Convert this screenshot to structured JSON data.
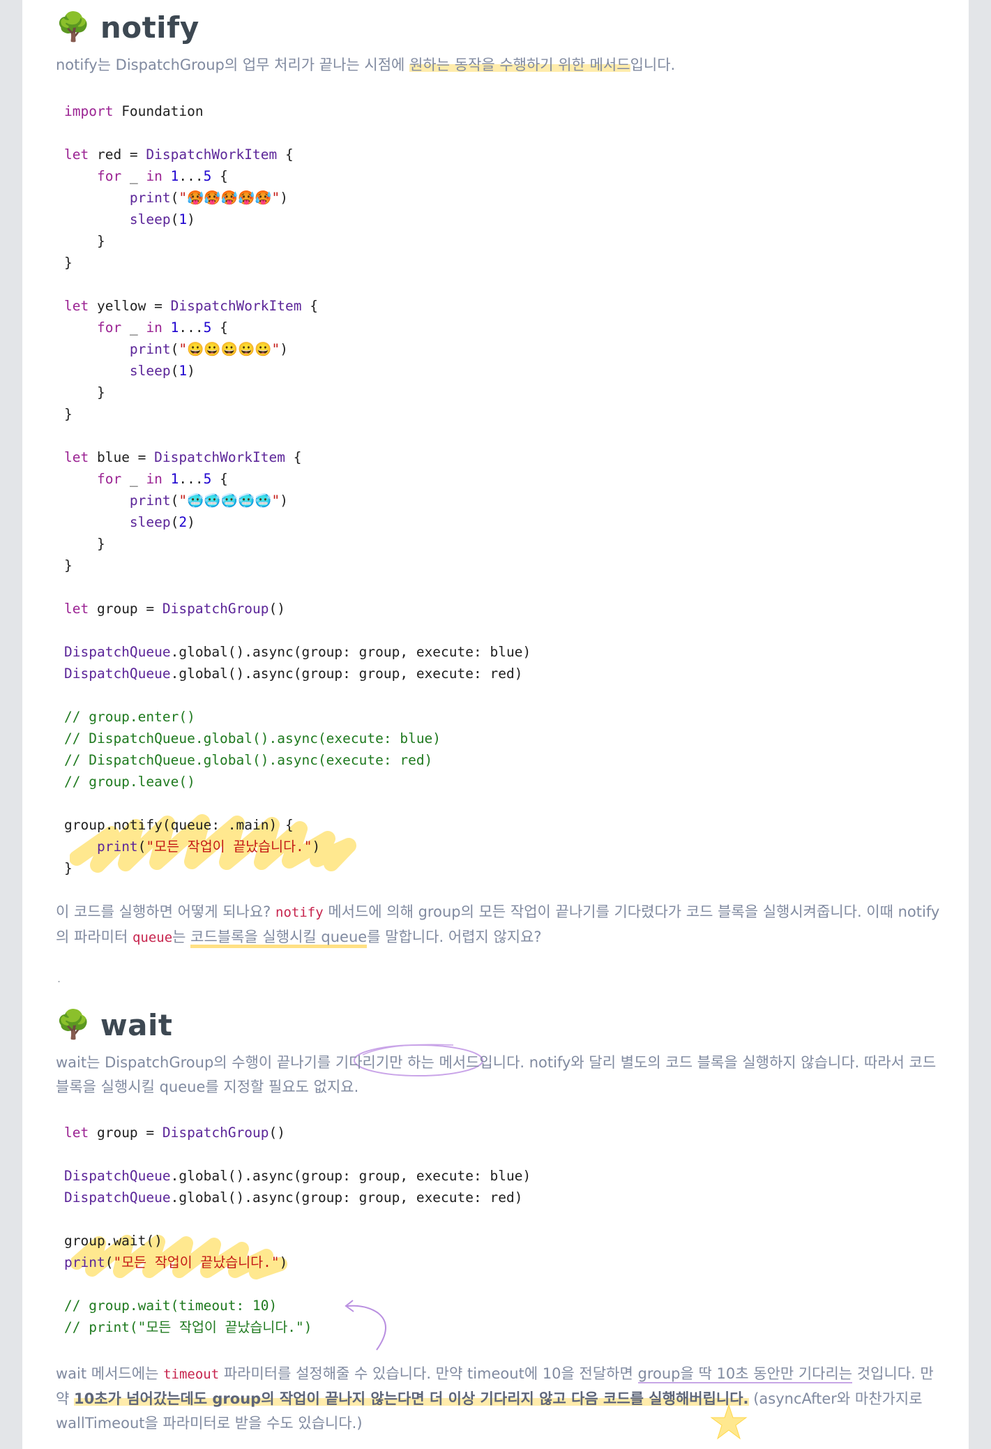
{
  "sections": {
    "notify": {
      "title": "notify",
      "intro_prefix": "notify는 DispatchGroup의 업무 처리가 끝나는 시점에 ",
      "intro_highlight": "원하는 동작을 수행하기 위한 메서드",
      "intro_suffix": "입니다.",
      "code": [
        "import Foundation",
        "",
        "let red = DispatchWorkItem {",
        "    for _ in 1...5 {",
        "        print(\"🥵🥵🥵🥵🥵\")",
        "        sleep(1)",
        "    }",
        "}",
        "",
        "let yellow = DispatchWorkItem {",
        "    for _ in 1...5 {",
        "        print(\"😀😀😀😀😀\")",
        "        sleep(1)",
        "    }",
        "}",
        "",
        "let blue = DispatchWorkItem {",
        "    for _ in 1...5 {",
        "        print(\"🥶🥶🥶🥶🥶\")",
        "        sleep(2)",
        "    }",
        "}",
        "",
        "let group = DispatchGroup()",
        "",
        "DispatchQueue.global().async(group: group, execute: blue)",
        "DispatchQueue.global().async(group: group, execute: red)",
        "",
        "// group.enter()",
        "// DispatchQueue.global().async(execute: blue)",
        "// DispatchQueue.global().async(execute: red)",
        "// group.leave()",
        "",
        "group.notify(queue: .main) {",
        "    print(\"모든 작업이 끝났습니다.\")",
        "}"
      ],
      "outro": {
        "t1": "이 코드를 실행하면 어떻게 되나요? ",
        "c1": "notify",
        "t2": " 메서드에 의해 group의 모든 작업이 끝나기를 기다렸다가 코드 블록을 실행시켜줍니다. 이때 notify의 파라미터 ",
        "c2": "queue",
        "t3": "는 ",
        "u1": "코드블록을 실행시킬 queue",
        "t4": "를 말합니다. 어렵지 않지요?"
      },
      "separator": "."
    },
    "wait": {
      "title": "wait",
      "intro_p1": "wait는 DispatchGroup의 수행이 끝나기를 ",
      "intro_circle": "기다리기만",
      "intro_p2": " 하는 메서드입니다. notify와 달리 별도의 코드 블록을 실행하지 않습니다. 따라서 코드 블록을 실행시킬 queue를 지정할 필요도 없지요.",
      "code": [
        "let group = DispatchGroup()",
        "",
        "DispatchQueue.global().async(group: group, execute: blue)",
        "DispatchQueue.global().async(group: group, execute: red)",
        "",
        "group.wait()",
        "print(\"모든 작업이 끝났습니다.\")",
        "",
        "// group.wait(timeout: 10)",
        "// print(\"모든 작업이 끝났습니다.\")"
      ],
      "outro": {
        "t1": "wait 메서드에는 ",
        "c1": "timeout",
        "t2": " 파라미터를 설정해줄 수 있습니다. 만약 timeout에 10을 전달하면 ",
        "u1": "group을 딱 10초 동안만 기다리는",
        "t3": " 것입니다. 만약 ",
        "b1": "10초가 넘어갔는데도 group의 작업이 끝나지 않는다면 더 이상 기다리지 않고 다음 코드를 실행해버립니다.",
        "t4": " (asyncAfter와 마찬가지로 wallTimeout을 파라미터로 받을 수도 있습니다.)"
      }
    }
  },
  "colors": {
    "text": "#808aa0",
    "heading": "#3d4852",
    "highlight": "#ffe078",
    "inline_code": "#c7254e",
    "keyword": "#9b2393",
    "type": "#5c2699",
    "number": "#1c00cf",
    "string": "#c41a16",
    "comment": "#1f7a1f"
  },
  "icons": [
    "tree-icon",
    "arrow-annotation-icon",
    "star-annotation-icon"
  ]
}
